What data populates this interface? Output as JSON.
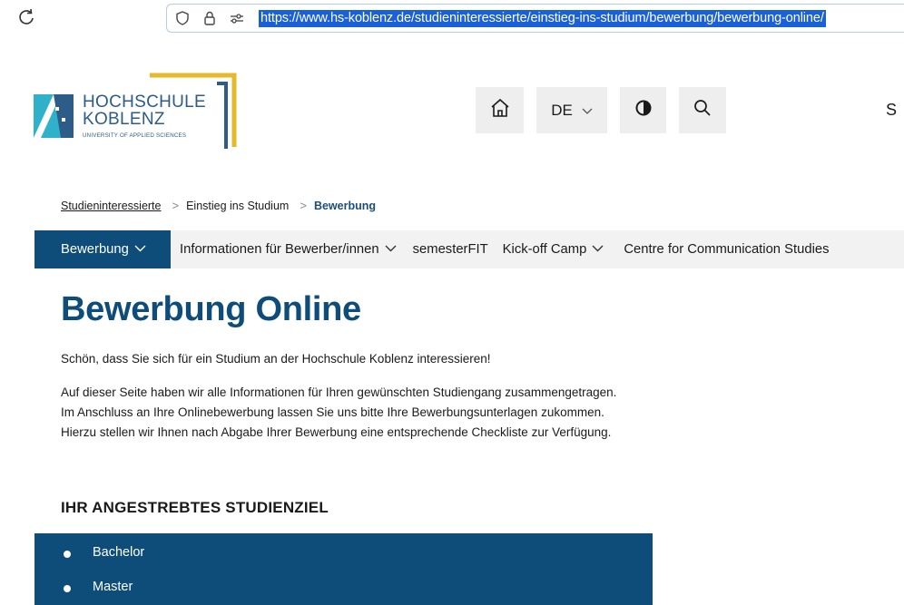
{
  "browser": {
    "url": "https://www.hs-koblenz.de/studieninteressierte/einstieg-ins-studium/bewerbung/bewerbung-online/"
  },
  "logo": {
    "line1": "HOCHSCHULE",
    "line2": "KOBLENZ",
    "line3": "UNIVERSITY OF APPLIED SCIENCES",
    "colors": {
      "primary": "#2d5c88",
      "accent_gold": "#e5b92a",
      "mark_cyan": "#2fb2c9"
    }
  },
  "header": {
    "home_icon": "home-icon",
    "language": "DE",
    "contrast_icon": "contrast-icon",
    "search_icon": "search-icon",
    "cut_text": "S"
  },
  "breadcrumb": {
    "items": [
      "Studieninteressierte",
      "Einstieg ins Studium",
      "Bewerbung"
    ],
    "separator": ">"
  },
  "subnav": {
    "items": [
      {
        "label": "Bewerbung",
        "has_dropdown": true,
        "active": true
      },
      {
        "label": "Informationen für Bewerber/innen",
        "has_dropdown": true,
        "active": false
      },
      {
        "label": "semesterFIT",
        "has_dropdown": false,
        "active": false
      },
      {
        "label": "Kick-off Camp",
        "has_dropdown": true,
        "active": false
      },
      {
        "label": "Centre for Communication Studies",
        "has_dropdown": false,
        "active": false
      }
    ]
  },
  "main": {
    "title": "Bewerbung Online",
    "intro": "Schön, dass Sie sich für ein Studium an der Hochschule Koblenz interessieren!",
    "paragraph": [
      "Auf dieser Seite haben wir alle Informationen für Ihren gewünschten Studiengang zusammengetragen.",
      "Im Anschluss an Ihre Onlinebewerbung lassen Sie uns bitte Ihre Bewerbungsunterlagen zukommen.",
      "Hierzu stellen wir Ihnen nach Abgabe Ihrer Bewerbung eine entsprechende Checkliste zur Verfügung."
    ],
    "section_heading": "IHR ANGESTREBTES STUDIENZIEL",
    "goals": [
      "Bachelor",
      "Master"
    ],
    "colors": {
      "brand_blue": "#0e4c7a"
    }
  }
}
